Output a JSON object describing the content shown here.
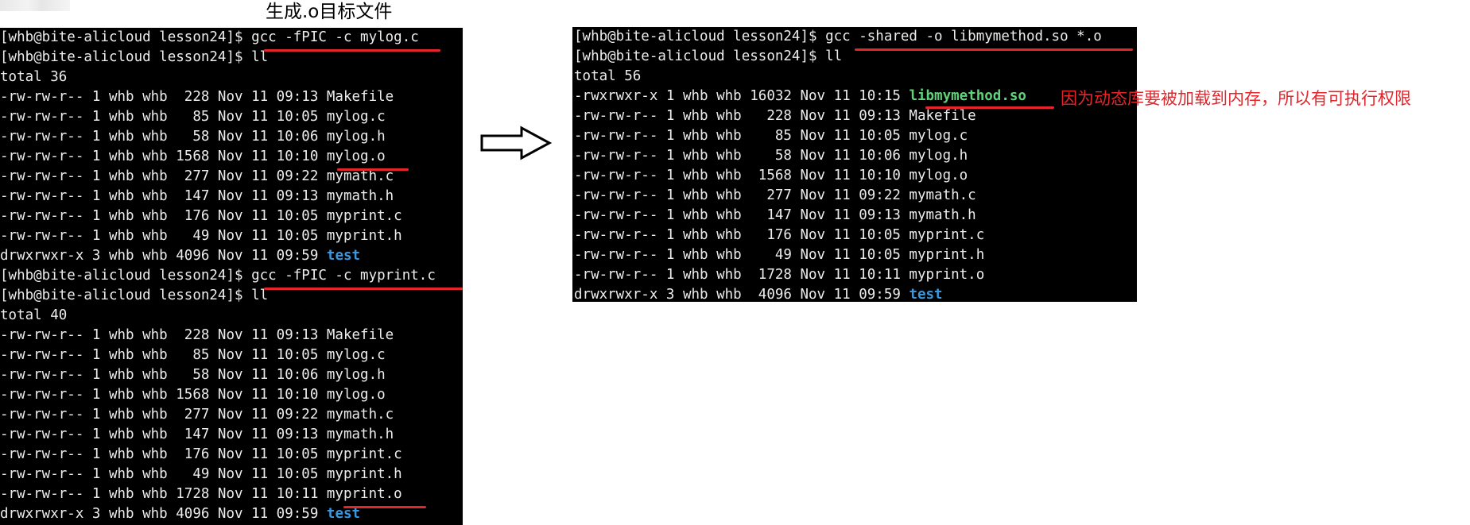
{
  "caption": "生成.o目标文件",
  "note": "因为动态库要被加载到内存，所以有可执行权限",
  "colors": {
    "terminal_bg": "#000000",
    "text": "#ececec",
    "dir": "#3a96dd",
    "exec": "#5fd37a",
    "highlight": "#e3262c"
  },
  "left_terminal": {
    "lines": [
      "[whb@bite-alicloud lesson24]$ gcc -fPIC -c mylog.c",
      "[whb@bite-alicloud lesson24]$ ll",
      "total 36",
      "-rw-rw-r-- 1 whb whb  228 Nov 11 09:13 Makefile",
      "-rw-rw-r-- 1 whb whb   85 Nov 11 10:05 mylog.c",
      "-rw-rw-r-- 1 whb whb   58 Nov 11 10:06 mylog.h",
      "-rw-rw-r-- 1 whb whb 1568 Nov 11 10:10 mylog.o",
      "-rw-rw-r-- 1 whb whb  277 Nov 11 09:22 mymath.c",
      "-rw-rw-r-- 1 whb whb  147 Nov 11 09:13 mymath.h",
      "-rw-rw-r-- 1 whb whb  176 Nov 11 10:05 myprint.c",
      "-rw-rw-r-- 1 whb whb   49 Nov 11 10:05 myprint.h",
      "drwxrwxr-x 3 whb whb 4096 Nov 11 09:59 ",
      "[whb@bite-alicloud lesson24]$ gcc -fPIC -c myprint.c",
      "[whb@bite-alicloud lesson24]$ ll",
      "total 40",
      "-rw-rw-r-- 1 whb whb  228 Nov 11 09:13 Makefile",
      "-rw-rw-r-- 1 whb whb   85 Nov 11 10:05 mylog.c",
      "-rw-rw-r-- 1 whb whb   58 Nov 11 10:06 mylog.h",
      "-rw-rw-r-- 1 whb whb 1568 Nov 11 10:10 mylog.o",
      "-rw-rw-r-- 1 whb whb  277 Nov 11 09:22 mymath.c",
      "-rw-rw-r-- 1 whb whb  147 Nov 11 09:13 mymath.h",
      "-rw-rw-r-- 1 whb whb  176 Nov 11 10:05 myprint.c",
      "-rw-rw-r-- 1 whb whb   49 Nov 11 10:05 myprint.h",
      "-rw-rw-r-- 1 whb whb 1728 Nov 11 10:11 myprint.o",
      "drwxrwxr-x 3 whb whb 4096 Nov 11 09:59 "
    ],
    "dir_name": "test"
  },
  "right_terminal": {
    "lines": [
      "[whb@bite-alicloud lesson24]$ gcc -shared -o libmymethod.so *.o",
      "[whb@bite-alicloud lesson24]$ ll",
      "total 56",
      "-rwxrwxr-x 1 whb whb 16032 Nov 11 10:15 ",
      "-rw-rw-r-- 1 whb whb   228 Nov 11 09:13 Makefile",
      "-rw-rw-r-- 1 whb whb    85 Nov 11 10:05 mylog.c",
      "-rw-rw-r-- 1 whb whb    58 Nov 11 10:06 mylog.h",
      "-rw-rw-r-- 1 whb whb  1568 Nov 11 10:10 mylog.o",
      "-rw-rw-r-- 1 whb whb   277 Nov 11 09:22 mymath.c",
      "-rw-rw-r-- 1 whb whb   147 Nov 11 09:13 mymath.h",
      "-rw-rw-r-- 1 whb whb   176 Nov 11 10:05 myprint.c",
      "-rw-rw-r-- 1 whb whb    49 Nov 11 10:05 myprint.h",
      "-rw-rw-r-- 1 whb whb  1728 Nov 11 10:11 myprint.o",
      "drwxrwxr-x 3 whb whb  4096 Nov 11 09:59 "
    ],
    "lib_name": "libmymethod.so",
    "dir_name": "test"
  },
  "arrow_icon": "right-arrow-icon"
}
